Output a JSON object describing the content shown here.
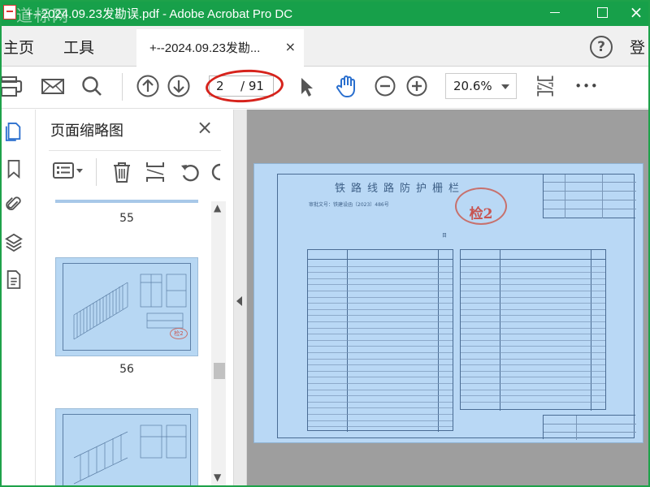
{
  "window": {
    "title": "+--2024.09.23发勘误.pdf - Adobe Acrobat Pro DC",
    "watermark": "道标网",
    "close_glyph": "×"
  },
  "menu": {
    "home": "主页",
    "tools": "工具",
    "signin": "登"
  },
  "tab": {
    "label": "+--2024.09.23发勘...",
    "close": "×"
  },
  "help": "?",
  "toolbar": {
    "page_current": "2",
    "page_total": "/ 91",
    "zoom": "20.6%",
    "more": "•••"
  },
  "thumbnails_panel": {
    "title": "页面缩略图",
    "close": "×",
    "pages": [
      "55",
      "56"
    ]
  },
  "document": {
    "title": "铁路线路防护栅栏",
    "subtitle": "审批文号：铁建设函〔2023〕486号",
    "stamp_text": "检2",
    "contents_heading": "目"
  },
  "colors": {
    "titlebar": "#17a04a",
    "page_highlight": "#b9d8f5",
    "annotation": "#d6231c"
  },
  "icons": [
    "print-icon",
    "mail-icon",
    "search-icon",
    "page-up-icon",
    "page-down-icon",
    "pointer-icon",
    "hand-icon",
    "zoom-out-icon",
    "zoom-in-icon",
    "fit-page-icon",
    "more-icon"
  ]
}
